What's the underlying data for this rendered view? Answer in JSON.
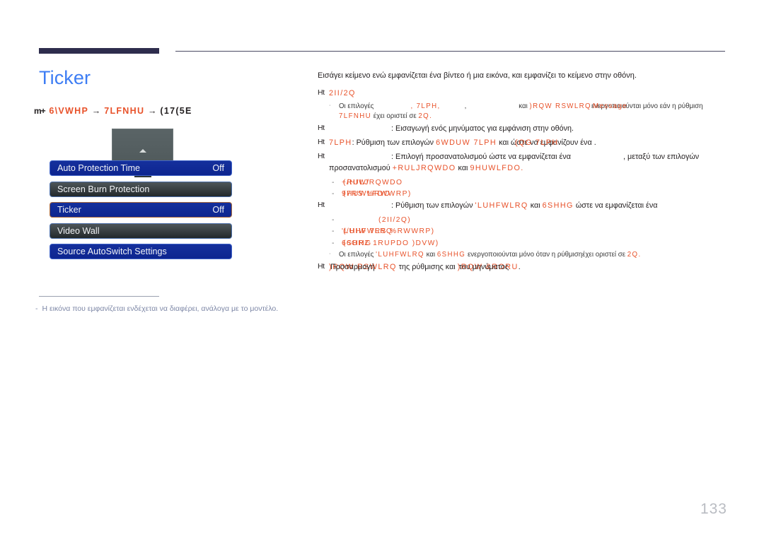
{
  "page": {
    "number": "133",
    "title": "Ticker",
    "title_color": "#3d7df4",
    "accent_red": "#e8522a",
    "header_bar_color": "#2e2d4d"
  },
  "breadcrumb": {
    "icon": "m+",
    "part1": "6\\VWHP",
    "arrow1": "→",
    "part2": "7LFNHU",
    "arrow2": "→",
    "part3": "(17(5E"
  },
  "osd": {
    "rows": [
      {
        "label": "Auto Protection Time",
        "value": "Off",
        "state": "selected"
      },
      {
        "label": "Screen Burn Protection",
        "value": "",
        "state": "unselected"
      },
      {
        "label": "Ticker",
        "value": "Off",
        "state": "highlighted"
      },
      {
        "label": "Video Wall",
        "value": "",
        "state": "unselected"
      },
      {
        "label": "Source AutoSwitch Settings",
        "value": "",
        "state": "selected"
      }
    ]
  },
  "footnote": {
    "dash": "-",
    "text": "Η εικόνα που εμφανίζεται ενδέχεται να διαφέρει, ανάλογα με το μοντέλο."
  },
  "content": {
    "intro": "Εισάγει κείμενο ενώ εμφανίζεται ένα βίντεο ή μια εικόνα, και εμφανίζει το κείμενο στην οθόνη.",
    "marker": "Ht",
    "bullet_small": "‧",
    "bullet_dash": "-",
    "b1": {
      "title": "2II/2Q",
      "note_a": "Οι επιλογές",
      "note_b": ", 7LPH,",
      "note_c": ",",
      "note_d": "και",
      "note_e": ")RQW RSWLRQ",
      "note_f_under": "ενεργοποιούνται",
      "note_f_over": "Message",
      "note_g": "μόνο εάν η ρύθμιση",
      "note_h": "7LFNHU",
      "note_i": "έχει οριστεί σε",
      "note_j": "2Q."
    },
    "b2": {
      "text": ": Εισαγωγή ενός μηνύματος για εμφάνιση στην οθόνη."
    },
    "b3": {
      "label": "7LPH",
      "text_a": ": Ρύθμιση των επιλογών",
      "red_a": "6WDUW 7LPH",
      "text_b": "και",
      "over_under": "ώστε να εμφανίζουν ένα",
      "over_top": "(QG 7LPH",
      "text_c": "."
    },
    "b4": {
      "text_a": ": Επιλογή προσανατολισμού ώστε να εμφανίζεται ένα",
      "text_b": ", μεταξύ των επιλογών",
      "text_c": "προσανατολισμού",
      "red_a": "+RULJRQWDO",
      "text_d": "και",
      "red_b": "9HUWLFDO.",
      "sub1_under": "+RULJRQWDO",
      "sub1_over": "(/HIW/",
      "sub2_under": "9HUWLFDO",
      "sub2_over": "(7RS %RWWRP)"
    },
    "b5": {
      "text_a": ": Ρύθμιση των επιλογών",
      "red_a": "'LUHFWLRQ",
      "text_b": "και",
      "red_b": "6SHHG",
      "text_c": "ώστε να εμφανίζεται ένα",
      "sub1": "(2II/2Q)",
      "sub2_under": "'LUHFWLRQ",
      "sub2_over": "(/HIW 7RS %RWWRP)",
      "sub3_under": "6SHHG",
      "sub3_over": "(6ORZ 1RUPDO )DVW)",
      "note_a": "Οι επιλογές",
      "note_b": "'LUHFWLRQ",
      "note_c": "και",
      "note_d": "6SHHG",
      "note_e": "ενεργοποιούνται μόνο όταν η ρύθμιση",
      "note_f": "έχει οριστεί σε",
      "note_g": "2Q."
    },
    "b6": {
      "red_a": ")RQW RSWLRQ",
      "over_a": "Προσαρμογή",
      "text_a": "της ρύθμισης",
      "text_b": "και",
      "red_b": ")RQW &RORU",
      "over_b": "του μηνύματος",
      "text_c": "."
    }
  }
}
